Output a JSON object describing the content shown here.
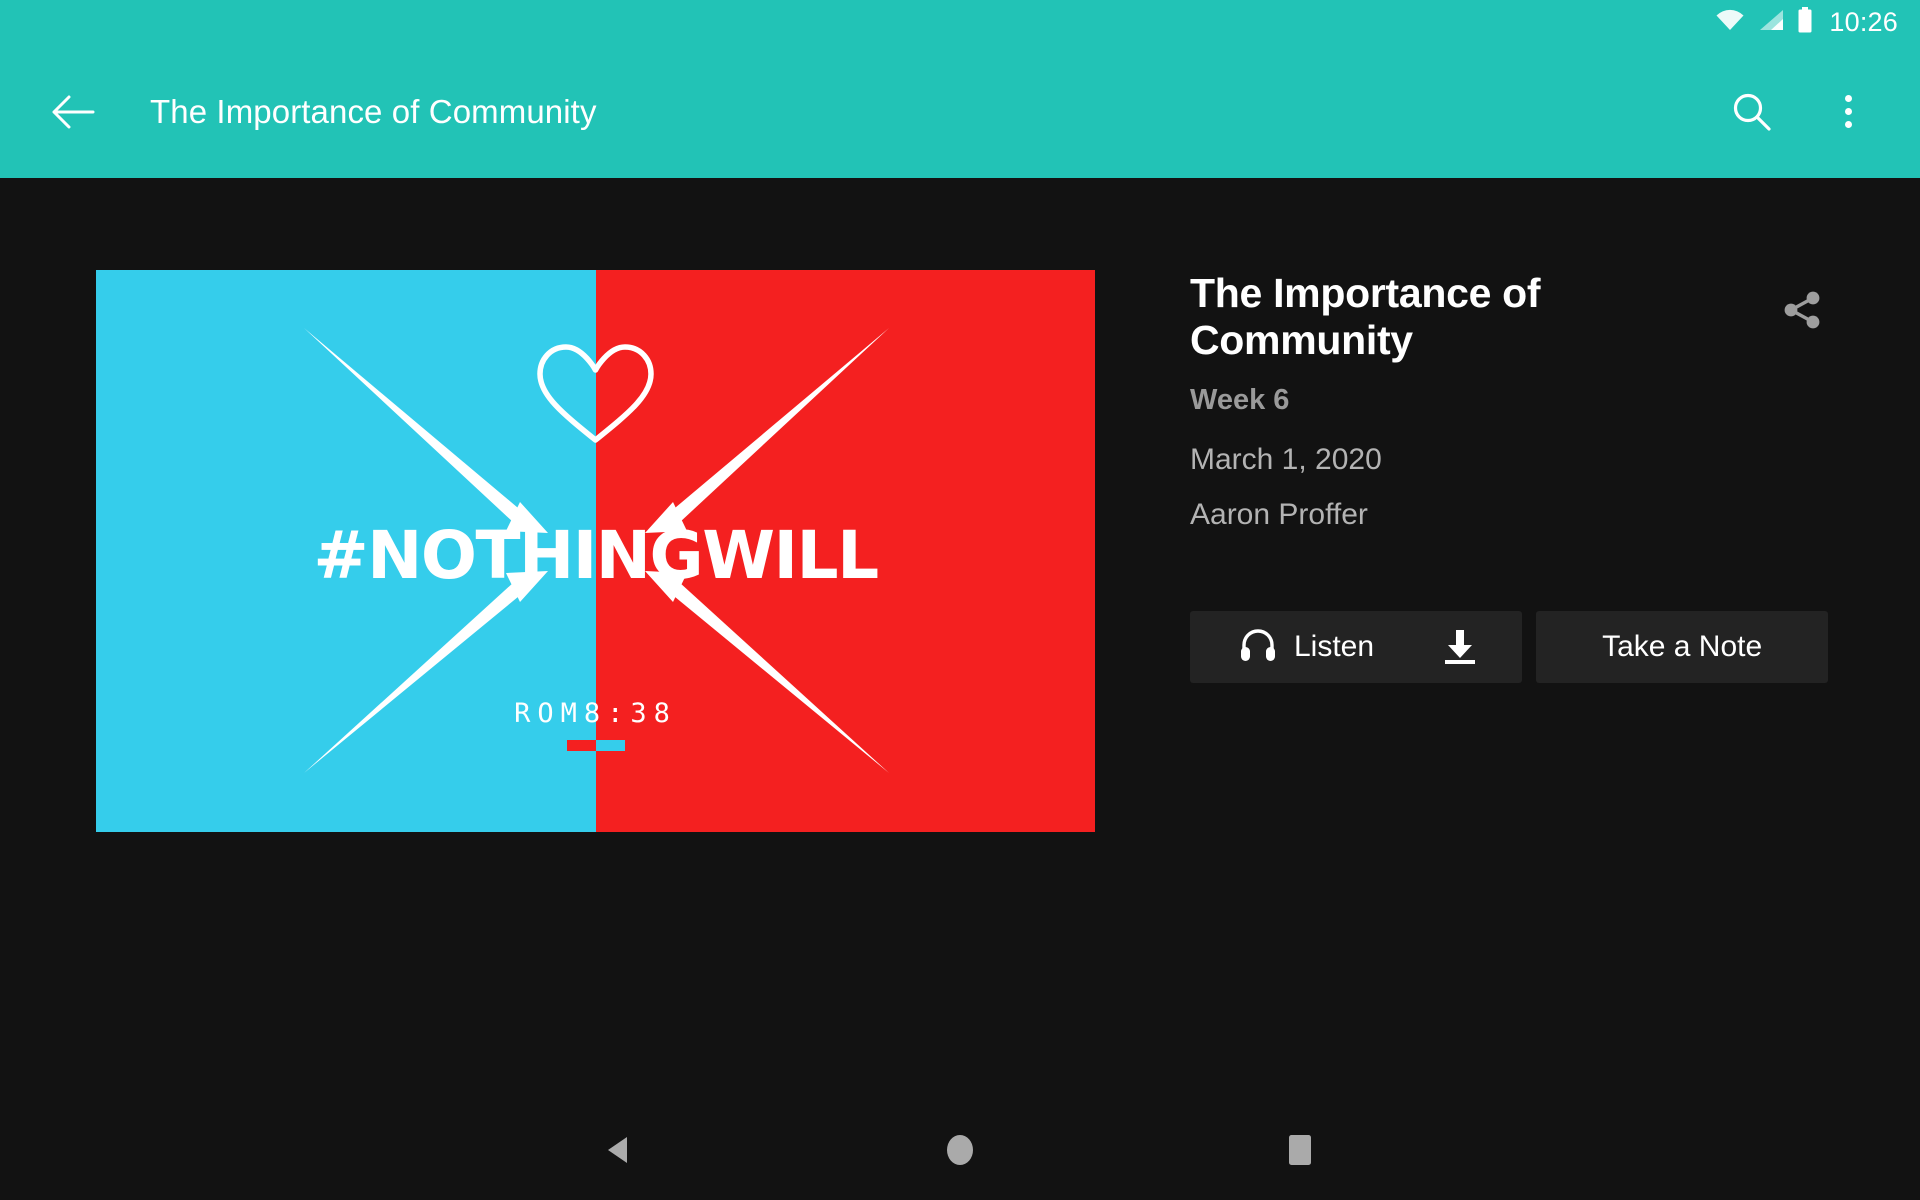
{
  "status_bar": {
    "time": "10:26",
    "icons": [
      "wifi-icon",
      "cellular-signal-icon",
      "battery-icon"
    ],
    "background": "#22C3B6"
  },
  "app_bar": {
    "back_icon": "back-arrow-icon",
    "title": "The Importance of Community",
    "search_icon": "search-icon",
    "overflow_icon": "overflow-menu-icon",
    "background": "#22C3B6"
  },
  "artwork": {
    "heading": "#NOTHINGWILL",
    "verse_prefix": "ROM",
    "verse_suffix": "8:38",
    "verse_full": "ROM8:38",
    "heart_icon": "heart-outline-icon",
    "arrow_count": 4,
    "colors": {
      "left": "#35CDEB",
      "right": "#F42020",
      "text": "#FFFFFF"
    }
  },
  "details": {
    "title": "The Importance of Community",
    "week": "Week 6",
    "date": "March 1, 2020",
    "speaker": "Aaron Proffer",
    "share_icon": "share-icon"
  },
  "actions": {
    "listen_label": "Listen",
    "listen_icon": "headphones-icon",
    "download_icon": "download-icon",
    "note_label": "Take a Note",
    "button_background": "#232323"
  },
  "nav_bar": {
    "back_icon": "nav-back-triangle-icon",
    "home_icon": "nav-home-circle-icon",
    "recents_icon": "nav-recents-square-icon",
    "icon_color": "#AAAAAA"
  },
  "theme": {
    "accent": "#22C3B6",
    "background": "#121212",
    "text_primary": "#FFFFFF",
    "text_secondary": "#B3B3B3",
    "text_muted": "#9A9A9A"
  }
}
